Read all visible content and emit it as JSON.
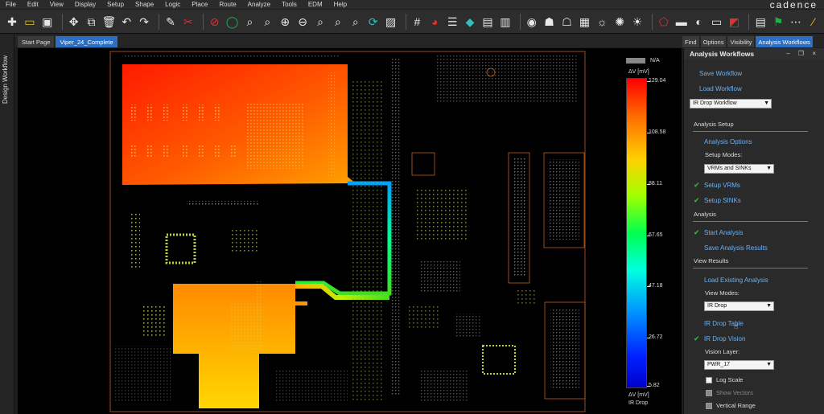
{
  "menu": [
    "File",
    "Edit",
    "View",
    "Display",
    "Setup",
    "Shape",
    "Logic",
    "Place",
    "Route",
    "Analyze",
    "Tools",
    "EDM",
    "Help"
  ],
  "brand": "cadence",
  "left_panel": {
    "label": "Design Workflow"
  },
  "tabs": [
    "Start Page",
    "Viper_24_Complete"
  ],
  "right_tabs": [
    "Find",
    "Options",
    "Visibility",
    "Analysis Workflows"
  ],
  "panel": {
    "title": "Analysis Workflows",
    "controls": "– ❐ ×",
    "save_workflow": "Save Workflow",
    "load_workflow": "Load Workflow",
    "workflow_select": "IR Drop Workflow",
    "analysis_setup": "Analysis Setup",
    "analysis_options": "Analysis Options",
    "setup_modes_label": "Setup Modes:",
    "setup_modes_value": "VRMs and SINKs",
    "setup_vrms": "Setup VRMs",
    "setup_sinks": "Setup SINKs",
    "analysis": "Analysis",
    "start_analysis": "Start Analysis",
    "save_analysis_results": "Save Analysis Results",
    "view_results": "View Results",
    "load_existing_analysis": "Load Existing Analysis",
    "view_modes_label": "View Modes:",
    "view_modes_value": "IR Drop",
    "ir_drop_table": "IR Drop Table",
    "ir_drop_vision": "IR Drop Vision",
    "vision_layer_label": "Vision Layer:",
    "vision_layer_value": "PWR_17",
    "log_scale": "Log Scale",
    "show_vectors": "Show Vectors",
    "vertical_range": "Vertical Range"
  },
  "colorbar": {
    "na_label": "N/A",
    "header": "ΔV [mV]",
    "ticks": [
      "129.04",
      "108.58",
      "88.11",
      "67.65",
      "47.18",
      "26.72",
      "5.82"
    ],
    "footer": "ΔV [mV]",
    "footer2": "IR Drop"
  }
}
